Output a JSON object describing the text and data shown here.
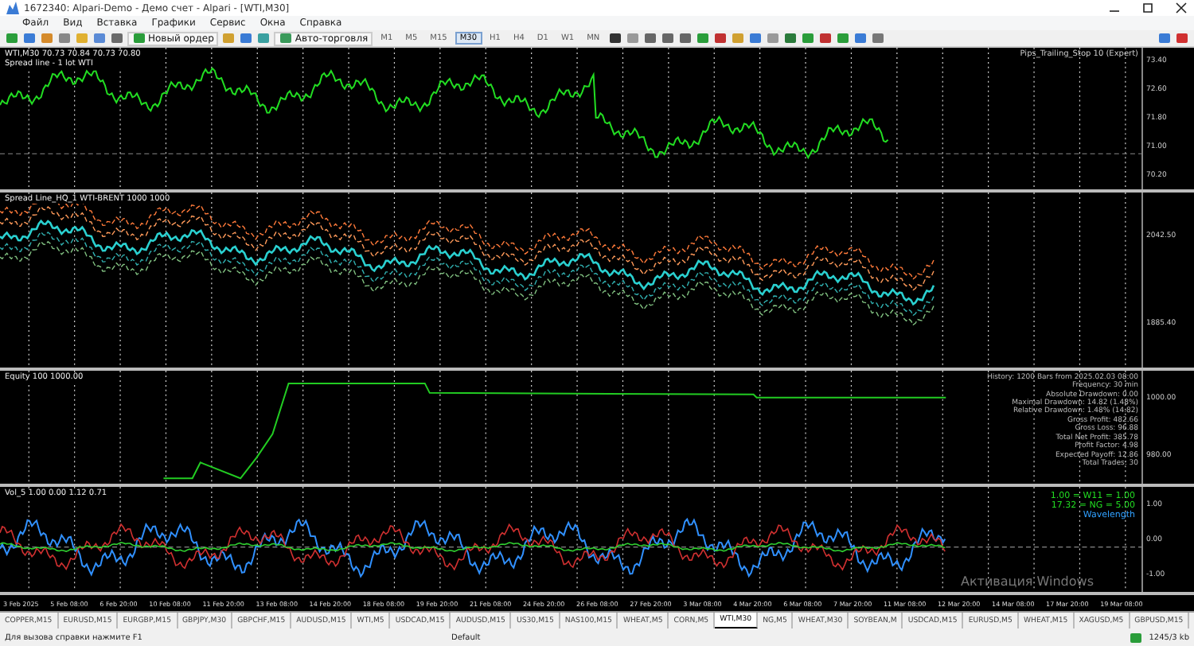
{
  "window": {
    "title": "1672340: Alpari-Demo - Демо счет - Alpari - [WTI,M30]"
  },
  "menu": [
    "Файл",
    "Вид",
    "Вставка",
    "Графики",
    "Сервис",
    "Окна",
    "Справка"
  ],
  "toolbar": {
    "new_order": "Новый ордер",
    "auto_trading": "Авто-торговля",
    "timeframes": [
      {
        "label": "M1",
        "selected": false
      },
      {
        "label": "M5",
        "selected": false
      },
      {
        "label": "M15",
        "selected": false
      },
      {
        "label": "M30",
        "selected": true
      },
      {
        "label": "H1",
        "selected": false
      },
      {
        "label": "H4",
        "selected": false
      },
      {
        "label": "D1",
        "selected": false
      },
      {
        "label": "W1",
        "selected": false
      },
      {
        "label": "MN",
        "selected": false
      }
    ]
  },
  "panes": [
    {
      "kind": "price",
      "header": [
        "WTI,M30 70.73 70.84 70.73 70.80",
        "Spread line - 1 lot WTI"
      ],
      "right_note": "Pips_Trailing_Stop 10 (Expert)",
      "scale": [
        "73.40",
        "72.60",
        "71.80",
        "71.00",
        "70.20"
      ]
    },
    {
      "kind": "bands",
      "header": [
        "Spread Line_HQ_1 WTI-BRENT 1000 1000"
      ],
      "scale": [
        "2042.50",
        "1885.40"
      ]
    },
    {
      "kind": "equity",
      "header": [
        "Equity 100 1000.00"
      ],
      "scale": [
        "1000.00",
        "980.00"
      ]
    },
    {
      "kind": "oscillator",
      "header": [
        "Vol_5 1.00 0.00 1.12 0.71"
      ],
      "scale": [
        "1.00",
        "0.00",
        "-1.00"
      ]
    }
  ],
  "info_lines": [
    "History: 1200 Bars from 2025.02.03 08:00",
    "Frequency: 30 min",
    "Absolute Drawdown: 0.00",
    "Maximal Drawdown: 14.82 (1.48%)",
    "Relative Drawdown: 1.48% (14.82)",
    "Gross Profit: 482.66",
    "Gross Loss: 96.88",
    "Total Net Profit: 385.78",
    "Profit Factor: 4.98",
    "Expected Payoff: 12.86",
    "Total Trades: 30"
  ],
  "osc_readout": [
    "1.00 = W11 = 1.00",
    "17.32 = NG = 5.00",
    "Wavelength"
  ],
  "time_axis": [
    "3 Feb 2025",
    "5 Feb 08:00",
    "6 Feb 20:00",
    "10 Feb 08:00",
    "11 Feb 20:00",
    "13 Feb 08:00",
    "14 Feb 20:00",
    "18 Feb 08:00",
    "19 Feb 20:00",
    "21 Feb 08:00",
    "24 Feb 20:00",
    "26 Feb 08:00",
    "27 Feb 20:00",
    "3 Mar 08:00",
    "4 Mar 20:00",
    "6 Mar 08:00",
    "7 Mar 20:00",
    "11 Mar 08:00",
    "12 Mar 20:00",
    "14 Mar 08:00",
    "17 Mar 20:00",
    "19 Mar 08:00"
  ],
  "chart_tabs": [
    {
      "label": "COPPER,M15",
      "selected": false
    },
    {
      "label": "EURUSD,M15",
      "selected": false
    },
    {
      "label": "EURGBP,M15",
      "selected": false
    },
    {
      "label": "GBPJPY,M30",
      "selected": false
    },
    {
      "label": "GBPCHF,M15",
      "selected": false
    },
    {
      "label": "AUDUSD,M15",
      "selected": false
    },
    {
      "label": "WTI,M5",
      "selected": false
    },
    {
      "label": "USDCAD,M15",
      "selected": false
    },
    {
      "label": "AUDUSD,M15",
      "selected": false
    },
    {
      "label": "US30,M15",
      "selected": false
    },
    {
      "label": "NAS100,M15",
      "selected": false
    },
    {
      "label": "WHEAT,M5",
      "selected": false
    },
    {
      "label": "CORN,M5",
      "selected": false
    },
    {
      "label": "WTI,M30",
      "selected": true
    },
    {
      "label": "NG,M5",
      "selected": false
    },
    {
      "label": "WHEAT,M30",
      "selected": false
    },
    {
      "label": "SOYBEAN,M",
      "selected": false
    },
    {
      "label": "USDCAD,M15",
      "selected": false
    },
    {
      "label": "EURUSD,M5",
      "selected": false
    },
    {
      "label": "WHEAT,M15",
      "selected": false
    },
    {
      "label": "XAGUSD,M5",
      "selected": false
    },
    {
      "label": "GBPUSD,M15",
      "selected": false
    }
  ],
  "activation_notice": "Активация Windows",
  "status_bar": {
    "help": "Для вызова справки нажмите F1",
    "profile": "Default",
    "traffic": "1245/3 kb"
  }
}
